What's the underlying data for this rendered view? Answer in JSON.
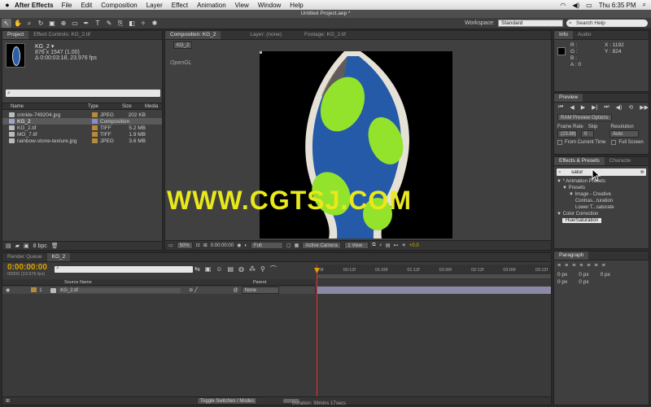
{
  "menubar": {
    "app": "After Effects",
    "items": [
      "File",
      "Edit",
      "Composition",
      "Layer",
      "Effect",
      "Animation",
      "View",
      "Window",
      "Help"
    ],
    "clock": "Thu 6:35 PM"
  },
  "window_title": "Untitled Project.aep *",
  "workspace": {
    "label": "Workspace:",
    "value": "Standard",
    "search_placeholder": "Search Help"
  },
  "project": {
    "tabs": [
      "Project",
      "Effect Controls: KG_2.tif"
    ],
    "selected_name": "KG_2 ▾",
    "selected_info": [
      "876 x 1547 (1.00)",
      "Δ 0:00:03:18, 23.976 fps"
    ],
    "columns": [
      "Name",
      "Type",
      "Size",
      "Media"
    ],
    "items": [
      {
        "name": "crinkle-749204.jpg",
        "type": "JPEG",
        "size": "202 KB",
        "color": "#b48a3c"
      },
      {
        "name": "KG_2",
        "type": "Composition",
        "size": "",
        "color": "#8a8ac8"
      },
      {
        "name": "KG_2.tif",
        "type": "TIFF",
        "size": "5.2 MB",
        "color": "#b48a3c"
      },
      {
        "name": "MO_7.tif",
        "type": "TIFF",
        "size": "1.9 MB",
        "color": "#b48a3c"
      },
      {
        "name": "rainbow-stone-texture.jpg",
        "type": "JPEG",
        "size": "3.6 MB",
        "color": "#b48a3c"
      }
    ],
    "bpc": "8 bpc"
  },
  "composition": {
    "tabs": [
      "Composition: KG_2",
      "Layer: (none)",
      "Footage: KG_2.tif"
    ],
    "sub_tab": "KG_2",
    "renderer": "OpenGL",
    "zoom": "50%",
    "timecode": "0:00:00:00",
    "resolution": "Full",
    "camera": "Active Camera",
    "views": "1 View",
    "exposure": "+0.0"
  },
  "watermark": "WWW.CGTSJ.COM",
  "info": {
    "tabs": [
      "Info",
      "Audio"
    ],
    "r": "R :",
    "g": "G :",
    "b": "B :",
    "a": "A : 0",
    "x": "X : 1192",
    "y": "Y : 824"
  },
  "preview": {
    "tab": "Preview",
    "options": "RAM Preview Options",
    "frame_rate_label": "Frame Rate",
    "skip_label": "Skip",
    "resolution_label": "Resolution",
    "frame_rate": "(23.98)",
    "skip": "0",
    "resolution": "Auto",
    "from_current": "From Current Time",
    "full_screen": "Full Screen"
  },
  "effects": {
    "tabs": [
      "Effects & Presets",
      "Characte"
    ],
    "search": "satur",
    "tree": [
      {
        "label": "▼ * Animation Presets",
        "indent": 0
      },
      {
        "label": "▼ Presets",
        "indent": 1
      },
      {
        "label": "▼ Image - Creative",
        "indent": 2
      },
      {
        "label": "Contras...turation",
        "indent": 3
      },
      {
        "label": "Lower T...saturate",
        "indent": 3
      },
      {
        "label": "▼ Color Correction",
        "indent": 0
      },
      {
        "label": "Hue/Saturation",
        "indent": 1
      }
    ]
  },
  "paragraph": {
    "tab": "Paragraph",
    "fields": [
      "0 px",
      "0 px",
      "0 px",
      "0 px",
      "0 px"
    ]
  },
  "timeline": {
    "tabs": [
      "Render Queue",
      "KG_2"
    ],
    "timecode": "0:00:00:00",
    "fps_line": "00000 (23.976 fps)",
    "columns": [
      "Source Name",
      "Parent"
    ],
    "layer_num": "1",
    "layer_name": "KG_2.tif",
    "parent": "None",
    "ruler": [
      "0f",
      "00:12f",
      "01:00f",
      "01:12f",
      "02:00f",
      "02:12f",
      "03:00f",
      "03:12f"
    ],
    "toggle": "Toggle Switches / Modes",
    "duration": "Duration: 38mins 17secs"
  }
}
